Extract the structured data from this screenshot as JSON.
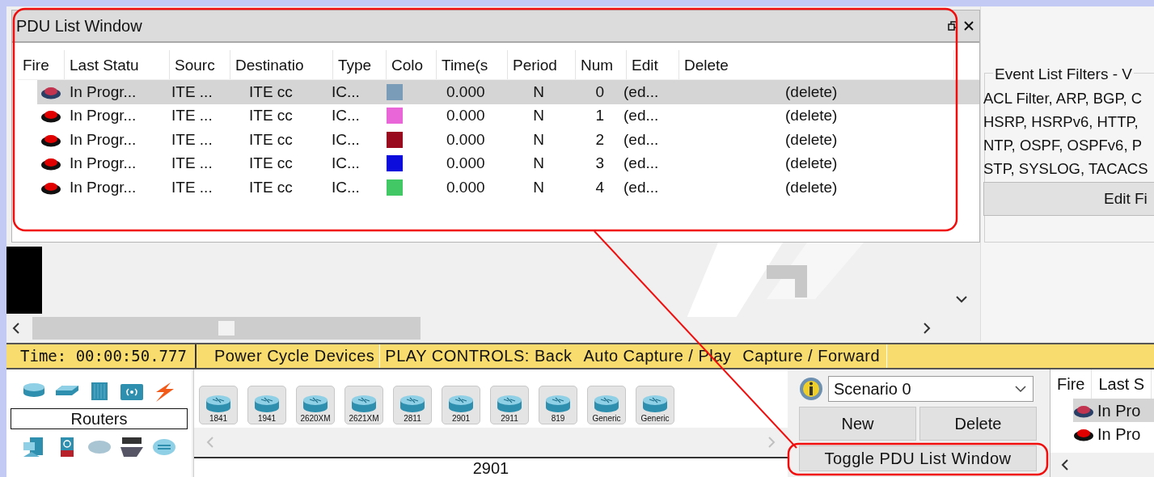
{
  "pdu_window": {
    "title": "PDU List Window",
    "columns": [
      "Fire",
      "Last Statu",
      "Sourc",
      "Destinatio",
      "Type",
      "Colo",
      "Time(s",
      "Period",
      "Num",
      "Edit",
      "Delete"
    ],
    "rows": [
      {
        "selected": true,
        "last_status": "In Progr...",
        "source": "ITE ...",
        "destination": "ITE cc",
        "type": "IC...",
        "color": "#7a9cb8",
        "time": "0.000",
        "periodic": "N",
        "num": "0",
        "edit": "(ed...",
        "delete": "(delete)"
      },
      {
        "selected": false,
        "last_status": "In Progr...",
        "source": "ITE ...",
        "destination": "ITE cc",
        "type": "IC...",
        "color": "#e966d8",
        "time": "0.000",
        "periodic": "N",
        "num": "1",
        "edit": "(ed...",
        "delete": "(delete)"
      },
      {
        "selected": false,
        "last_status": "In Progr...",
        "source": "ITE ...",
        "destination": "ITE cc",
        "type": "IC...",
        "color": "#9a0a1e",
        "time": "0.000",
        "periodic": "N",
        "num": "2",
        "edit": "(ed...",
        "delete": "(delete)"
      },
      {
        "selected": false,
        "last_status": "In Progr...",
        "source": "ITE ...",
        "destination": "ITE cc",
        "type": "IC...",
        "color": "#0c0cdd",
        "time": "0.000",
        "periodic": "N",
        "num": "3",
        "edit": "(ed...",
        "delete": "(delete)"
      },
      {
        "selected": false,
        "last_status": "In Progr...",
        "source": "ITE ...",
        "destination": "ITE cc",
        "type": "IC...",
        "color": "#43c866",
        "time": "0.000",
        "periodic": "N",
        "num": "4",
        "edit": "(ed...",
        "delete": "(delete)"
      }
    ]
  },
  "event_filters": {
    "title": "Event List Filters - V",
    "lines": [
      "ACL Filter, ARP, BGP, C",
      "HSRP, HSRPv6, HTTP,",
      "NTP, OSPF, OSPFv6, P",
      "STP, SYSLOG, TACACS"
    ],
    "button": "Edit Fi"
  },
  "status_bar": {
    "time": "Time: 00:00:50.777",
    "power_cycle": "Power Cycle Devices",
    "controls": [
      "PLAY CONTROLS:  Back",
      "Auto Capture / Play",
      "Capture / Forward"
    ]
  },
  "device_panel": {
    "category": "Routers",
    "models": [
      "1841",
      "1941",
      "2620XM",
      "2621XM",
      "2811",
      "2901",
      "2911",
      "819",
      "Generic",
      "Generic"
    ],
    "selected_model": "2901"
  },
  "scenario": {
    "value": "Scenario 0",
    "buttons": [
      "New",
      "Delete"
    ],
    "toggle": "Toggle PDU List Window"
  },
  "mini_pdu": {
    "columns": [
      "Fire",
      "Last S"
    ],
    "rows": [
      {
        "selected": true,
        "last_status": "In Pro"
      },
      {
        "selected": false,
        "last_status": "In Pro"
      }
    ]
  }
}
